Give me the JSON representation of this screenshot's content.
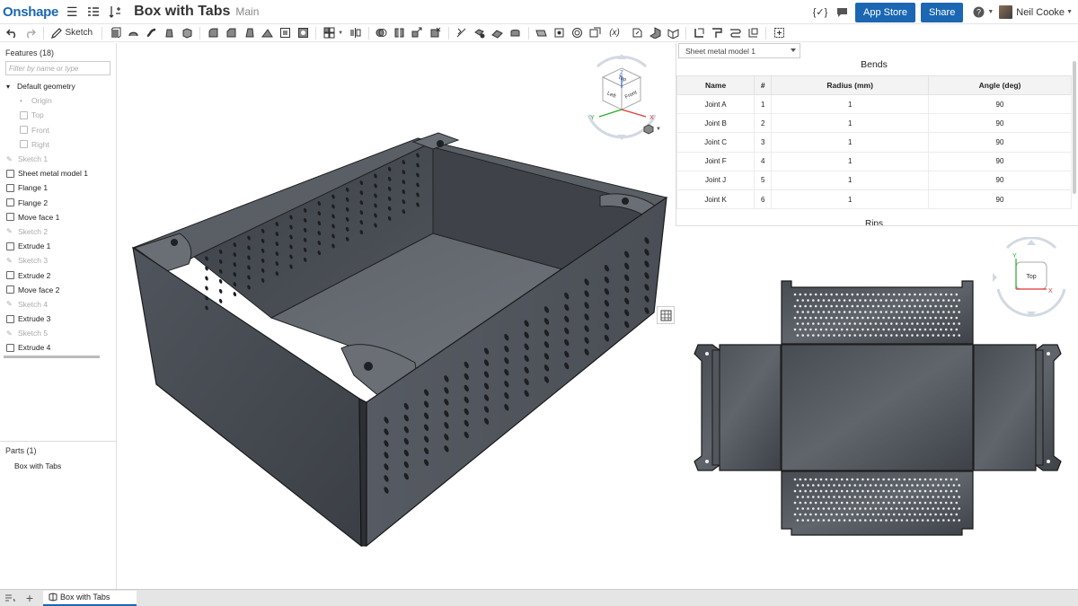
{
  "topbar": {
    "logo": "Onshape",
    "doc_title": "Box with Tabs",
    "branch": "Main",
    "app_store_label": "App Store",
    "share_label": "Share",
    "user_name": "Neil Cooke",
    "help_label": "?"
  },
  "toolbar": {
    "sketch_label": "Sketch",
    "variable_label": "(x)"
  },
  "features": {
    "header": "Features (18)",
    "filter_placeholder": "Filter by name or type",
    "items": [
      {
        "label": "Default geometry",
        "dim": false
      },
      {
        "label": "Origin",
        "dim": true
      },
      {
        "label": "Top",
        "dim": true
      },
      {
        "label": "Front",
        "dim": true
      },
      {
        "label": "Right",
        "dim": true
      },
      {
        "label": "Sketch 1",
        "dim": true
      },
      {
        "label": "Sheet metal model 1",
        "dim": false
      },
      {
        "label": "Flange 1",
        "dim": false
      },
      {
        "label": "Flange 2",
        "dim": false
      },
      {
        "label": "Move face 1",
        "dim": false
      },
      {
        "label": "Sketch 2",
        "dim": true
      },
      {
        "label": "Extrude 1",
        "dim": false
      },
      {
        "label": "Sketch 3",
        "dim": true
      },
      {
        "label": "Extrude 2",
        "dim": false
      },
      {
        "label": "Move face 2",
        "dim": false
      },
      {
        "label": "Sketch 4",
        "dim": true
      },
      {
        "label": "Extrude 3",
        "dim": false
      },
      {
        "label": "Sketch 5",
        "dim": true
      },
      {
        "label": "Extrude 4",
        "dim": false
      }
    ]
  },
  "parts": {
    "header": "Parts (1)",
    "items": [
      "Box with Tabs"
    ]
  },
  "view_cube": {
    "top_label": "Top",
    "left_label": "Left",
    "front_label": "Front",
    "axis_x": "X",
    "axis_y": "Y",
    "axis_z": "Z"
  },
  "flat_view_cube": {
    "top_label": "Top",
    "axis_x": "X",
    "axis_y": "Y"
  },
  "bends": {
    "select_value": "Sheet metal model 1",
    "title": "Bends",
    "columns": [
      "Name",
      "#",
      "Radius (mm)",
      "Angle (deg)"
    ],
    "rows": [
      [
        "Joint A",
        "1",
        "1",
        "90"
      ],
      [
        "Joint B",
        "2",
        "1",
        "90"
      ],
      [
        "Joint C",
        "3",
        "1",
        "90"
      ],
      [
        "Joint F",
        "4",
        "1",
        "90"
      ],
      [
        "Joint J",
        "5",
        "1",
        "90"
      ],
      [
        "Joint K",
        "6",
        "1",
        "90"
      ]
    ],
    "rips_title": "Rips"
  },
  "bottom": {
    "tab_label": "Box with Tabs"
  },
  "colors": {
    "accent": "#1b67b3",
    "model_gray": "#4a4f57",
    "model_dark": "#2f3338"
  }
}
